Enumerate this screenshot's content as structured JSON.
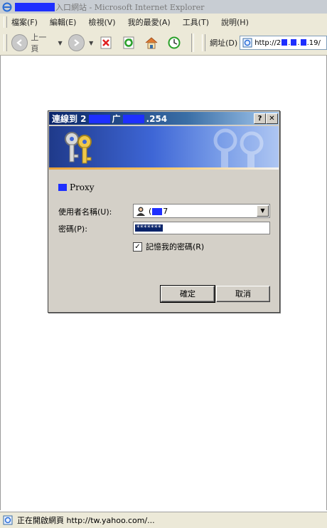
{
  "window": {
    "title": "入口網站 - Microsoft Internet Explorer"
  },
  "menu": {
    "items": [
      "檔案(F)",
      "編輯(E)",
      "檢視(V)",
      "我的最愛(A)",
      "工具(T)",
      "說明(H)"
    ]
  },
  "toolbar": {
    "back_label": "上一頁",
    "address_label": "網址(D)",
    "address_prefix": "http://2",
    "address_suffix": ".19/"
  },
  "dialog": {
    "title_prefix": "連線到 2",
    "title_mid": "广",
    "title_suffix": ".254",
    "help_button": "?",
    "close_button": "✕",
    "realm": "Proxy",
    "username_label": "使用者名稱(U):",
    "username_prefix": "(",
    "username_suffix": "7",
    "password_label": "密碼(P):",
    "password_value": "*******",
    "remember_label": "記憶我的密碼(R)",
    "remember_checked": true,
    "ok_label": "確定",
    "cancel_label": "取消"
  },
  "status": {
    "text": "正在開啟網頁 http://tw.yahoo.com/..."
  },
  "colors": {
    "titlebar_gradient_start": "#0a246a",
    "redaction_blue": "#1e2fff",
    "dialog_face": "#d4d0c8"
  }
}
